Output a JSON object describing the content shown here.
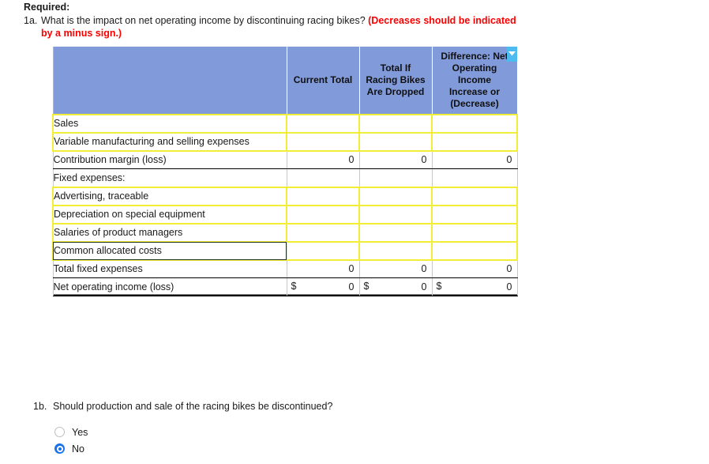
{
  "required": {
    "heading": "Required:",
    "q1a": {
      "number": "1a.",
      "text": "What is the impact on net operating income by discontinuing racing bikes?",
      "hint": "(Decreases should be indicated by a minus sign.)"
    },
    "q1b": {
      "number": "1b.",
      "text": "Should production and sale of the racing bikes be discontinued?",
      "options": [
        {
          "label": "Yes",
          "selected": false
        },
        {
          "label": "No",
          "selected": true
        }
      ]
    }
  },
  "table": {
    "headers": {
      "blank": "",
      "current_total": "Current Total",
      "total_if_dropped": "Total If Racing Bikes Are Dropped",
      "difference": "Difference: Net Operating Income Increase or (Decrease)"
    },
    "header_lines": {
      "total_if_dropped": [
        "Total If",
        "Racing Bikes",
        "Are Dropped"
      ],
      "difference": [
        "Difference: Net",
        "Operating",
        "Income",
        "Increase or",
        "(Decrease)"
      ]
    },
    "rows": [
      {
        "label": "Sales",
        "indent": false,
        "editable_label": true,
        "editable_cells": true,
        "current": "",
        "dropped": "",
        "difference": "",
        "dollar": false
      },
      {
        "label": "Variable manufacturing and selling expenses",
        "indent": false,
        "editable_label": true,
        "editable_cells": true,
        "current": "",
        "dropped": "",
        "difference": "",
        "dollar": false
      },
      {
        "label": "Contribution margin (loss)",
        "indent": false,
        "editable_label": false,
        "editable_cells": false,
        "current": "0",
        "dropped": "0",
        "difference": "0",
        "dollar": false
      },
      {
        "label": "Fixed expenses:",
        "indent": false,
        "editable_label": false,
        "editable_cells": false,
        "current": "",
        "dropped": "",
        "difference": "",
        "dollar": false
      },
      {
        "label": "Advertising, traceable",
        "indent": true,
        "editable_label": true,
        "editable_cells": true,
        "current": "",
        "dropped": "",
        "difference": "",
        "dollar": false
      },
      {
        "label": "Depreciation on special equipment",
        "indent": true,
        "editable_label": true,
        "editable_cells": true,
        "current": "",
        "dropped": "",
        "difference": "",
        "dollar": false
      },
      {
        "label": "Salaries of product managers",
        "indent": true,
        "editable_label": true,
        "editable_cells": true,
        "current": "",
        "dropped": "",
        "difference": "",
        "dollar": false
      },
      {
        "label": "Common allocated costs",
        "indent": true,
        "editable_label": true,
        "editable_cells": true,
        "current": "",
        "dropped": "",
        "difference": "",
        "dollar": false,
        "selected": true,
        "dropdown": "chevron-down-icon"
      },
      {
        "label": "Total fixed expenses",
        "indent": false,
        "editable_label": false,
        "editable_cells": false,
        "current": "0",
        "dropped": "0",
        "difference": "0",
        "dollar": false
      },
      {
        "label": "Net operating income (loss)",
        "indent": false,
        "editable_label": false,
        "editable_cells": false,
        "current": "0",
        "dropped": "0",
        "difference": "0",
        "dollar": true,
        "dollar_symbol": "$"
      }
    ]
  },
  "colors": {
    "header_blue": "#819ada",
    "editable_border": "#f2ee37",
    "hint_red": "#ff0000",
    "radio_blue": "#1a73e8",
    "dropdown_blue": "#4cbbf0"
  }
}
